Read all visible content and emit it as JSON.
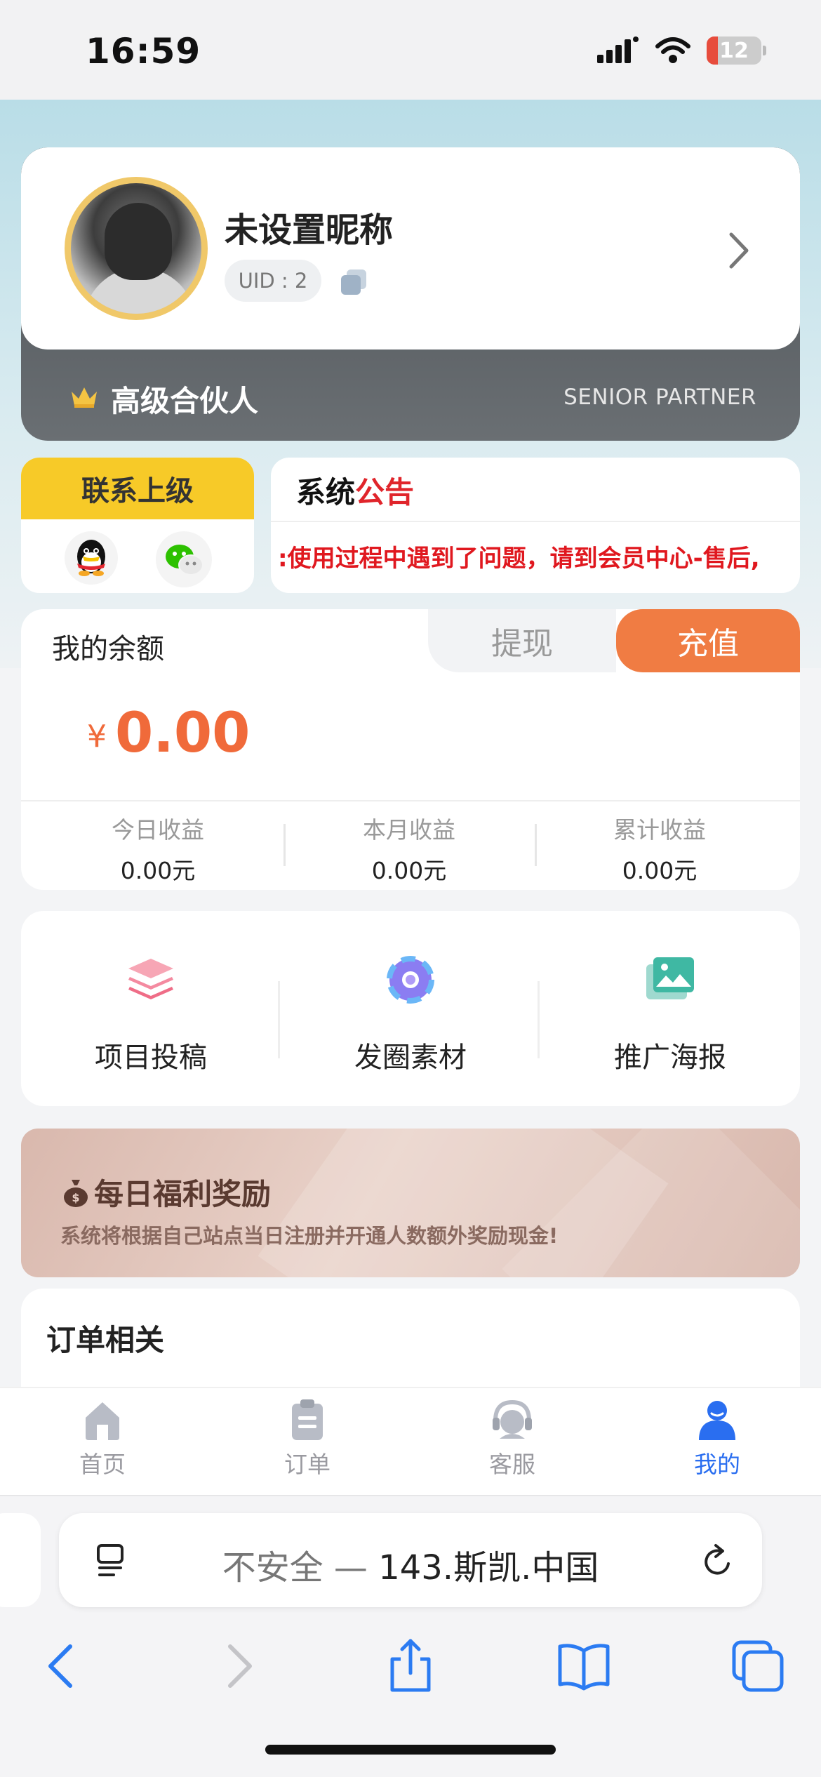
{
  "status_bar": {
    "time": "16:59",
    "battery": "12"
  },
  "profile": {
    "nickname": "未设置昵称",
    "uid": "UID : 2",
    "level_title": "高级合伙人",
    "level_en": "SENIOR PARTNER"
  },
  "contact": {
    "title": "联系上级",
    "icons": [
      "qq-icon",
      "wechat-icon"
    ]
  },
  "notice": {
    "title_part1": "系统",
    "title_part2": "公告",
    "text": ":使用过程中遇到了问题，请到会员中心-售后,"
  },
  "balance": {
    "label": "我的余额",
    "withdraw_label": "提现",
    "recharge_label": "充值",
    "currency": "¥",
    "amount": "0.00",
    "stats": [
      {
        "label": "今日收益",
        "value": "0.00元"
      },
      {
        "label": "本月收益",
        "value": "0.00元"
      },
      {
        "label": "累计收益",
        "value": "0.00元"
      }
    ]
  },
  "tools": [
    {
      "label": "项目投稿",
      "icon": "layers-icon"
    },
    {
      "label": "发圈素材",
      "icon": "aperture-icon"
    },
    {
      "label": "推广海报",
      "icon": "gallery-icon"
    }
  ],
  "bonus": {
    "title": "每日福利奖励",
    "subtitle": "系统将根据自己站点当日注册并开通人数额外奖励现金!"
  },
  "orders": {
    "title": "订单相关"
  },
  "tabbar": [
    {
      "label": "首页",
      "icon": "home-icon"
    },
    {
      "label": "订单",
      "icon": "clipboard-icon"
    },
    {
      "label": "客服",
      "icon": "headset-icon"
    },
    {
      "label": "我的",
      "icon": "user-icon",
      "active": true
    }
  ],
  "safari": {
    "insecure_label": "不安全 —",
    "domain": "143.斯凯.中国"
  },
  "colors": {
    "accent_orange": "#f07c43",
    "amount_red": "#f06a3a",
    "contact_yellow": "#f7ca28",
    "active_blue": "#2a6ef0"
  }
}
